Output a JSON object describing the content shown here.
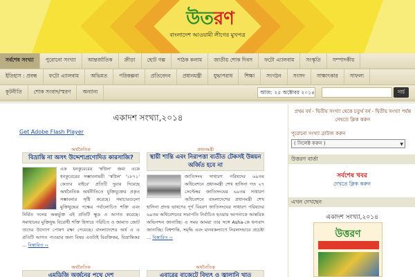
{
  "header": {
    "logo_part1": "উত",
    "logo_part2": "রণ",
    "tagline": "বাংলাদেশ আওয়ামী লীগের মুখপত্র"
  },
  "nav_row_1": [
    "সর্বশেষ সংখ্যা",
    "পুরোনো সংখ্যা",
    "আন্তর্জাতিক",
    "ক্রীড়া",
    "ছোট গল্প",
    "পাঠক কলাম",
    "জাতীয় শোক দিবস",
    "ফটো এ্যালবাম",
    "সংস্কৃতি",
    "সম্পাদকীয়"
  ],
  "nav_row_2": [
    "ইতিহাস : প্রবন্ধ",
    "ফটো এ্যালবাম",
    "অভিমত",
    "পরিকল্পনা",
    "প্রতিবেদন",
    "প্রধানমন্ত্রী",
    "যুদ্ধাপরাধ",
    "শিক্ষা",
    "সংগঠন",
    "সংসদ",
    "সাক্ষাৎকার",
    "সাফল্য"
  ],
  "nav_row_3": [
    "কূটনীতি",
    "শোক সংবাদ/স্মরণ",
    "অন্যান্য"
  ],
  "date_text": "আজ: ২৫ অক্টোবর ২০১৪",
  "search": {
    "button_label": "সার্চ",
    "value": ""
  },
  "main": {
    "title": "একাদশ সংখ্যা,২০১৪",
    "flash_link": "Get Adobe Flash Player",
    "posts": [
      {
        "category": "অর্থনৈতিক",
        "title": "বিভ্রান্তি না অসৎ উদ্দেশ্যপ্রণোদিত কারসাজি?",
        "body": "এক ধনকুবেরের 'স্বপ্নিল' জমা একে ধনকুবেরের সম্ভাবনাময়ী 'স্বপ্নিল' '১৮৭১' কেতাব বাইবে' প্রতিটি দুয়ার দিয়েছে অর্থনৈতিক অর্থনীতিতে যুক্তিযুক্তের প্রকৃত সম্ভাবনার সৃষ্টি করেছে। সমাচারগুলো মুক্তিযুদ্ধের পক্ষের পর্যালোচিত শক্তি এবং নির্মিত দলের অন্তর্ভুক্ত এই প্রতিটি ক্ষুদ্র ও আগত করেছে। সমাধানের মুক্তিযুদ্ধ বিরোধী শক্তি হিসাবে পরিচিত ও জামাত জোট তাদের উদ্যোগ পোষণ রক্ষা পেয়েছে। বাংলাদেশের অর্থ এ এ প্রতিটি আগত পাওয়ার জন্য বিষয় এতটাই বিরক্তিকর, বিভ্রান্তিকর ...",
        "more": "বিস্তারিত ››"
      },
      {
        "category": "প্রধানমন্ত্রী",
        "title": "স্থায়ী শান্তি এবং নিরাপত্তা ব্যতীত টেকসই উন্নয়ন অর্জিত হবে না",
        "body": "জাতিসংঘ সাধারণ পরিষদের ৬৯তম অধিবেশনে প্রধানমন্ত্রী শেখ হাসিনা গত ২৭ সেপ্টেম্বর জাতিসংঘের ৬৯তম সাধারণ অধিবেশনে বাংলাদেশের প্রধানমন্ত্রী শেখ হাসিনা প্রদত্ত ভাষণের পূর্ণ বিবরণ জাতিসংঘের সাধারণ পরিষদের ৬৯তম অধিবেশনের সভাপতি নির্বাচিত হওয়ায় আপনাকে আন্তরিক অভিনন্দন জানাচ্ছি। এ সময় আমরা তার সঙ্গে Asha-কে ধন্যবাদ জানাচ্ছি। বিশ্বশান্তি, সমৃদ্ধি এবং মানবকল্যাণে নিরলসভাবে প্রচেষ্টা ...",
        "more": "বিস্তারিত ››"
      },
      {
        "category": "অর্থনৈতিক",
        "title": "এমডিজি অর্জনের পথে দেশ",
        "body": "",
        "more": ""
      },
      {
        "category": "অর্থনৈতিক",
        "title": "এবারের বাজেটে বিদ্যুৎ ও জ্বালানি খাত",
        "body": "",
        "more": ""
      }
    ]
  },
  "sidebar": {
    "top_text": "প্রথম বর্ষ - দ্বিতীয় সংখ্যা থেকে চতুর্থ বর্ষ - দ্বিতীয় সংখ্যা পর্যন্ত দেখতে ক্লিক করুন",
    "archive_label": "পুরোনো সংখ্যা ব্রাউজ করুন",
    "archive_select": "( সিলেক্ট করুন )",
    "section_1": "উত্তরণ বার্তা",
    "latest_news": "সর্বশেষ খবর",
    "latest_click": "দেখতে ক্লিক করুন",
    "section_2": "এখন দেখছেন",
    "current_issue": "একাদশ সংখ্যা,২০১৪",
    "cover_logo": "উত্তরণ"
  }
}
